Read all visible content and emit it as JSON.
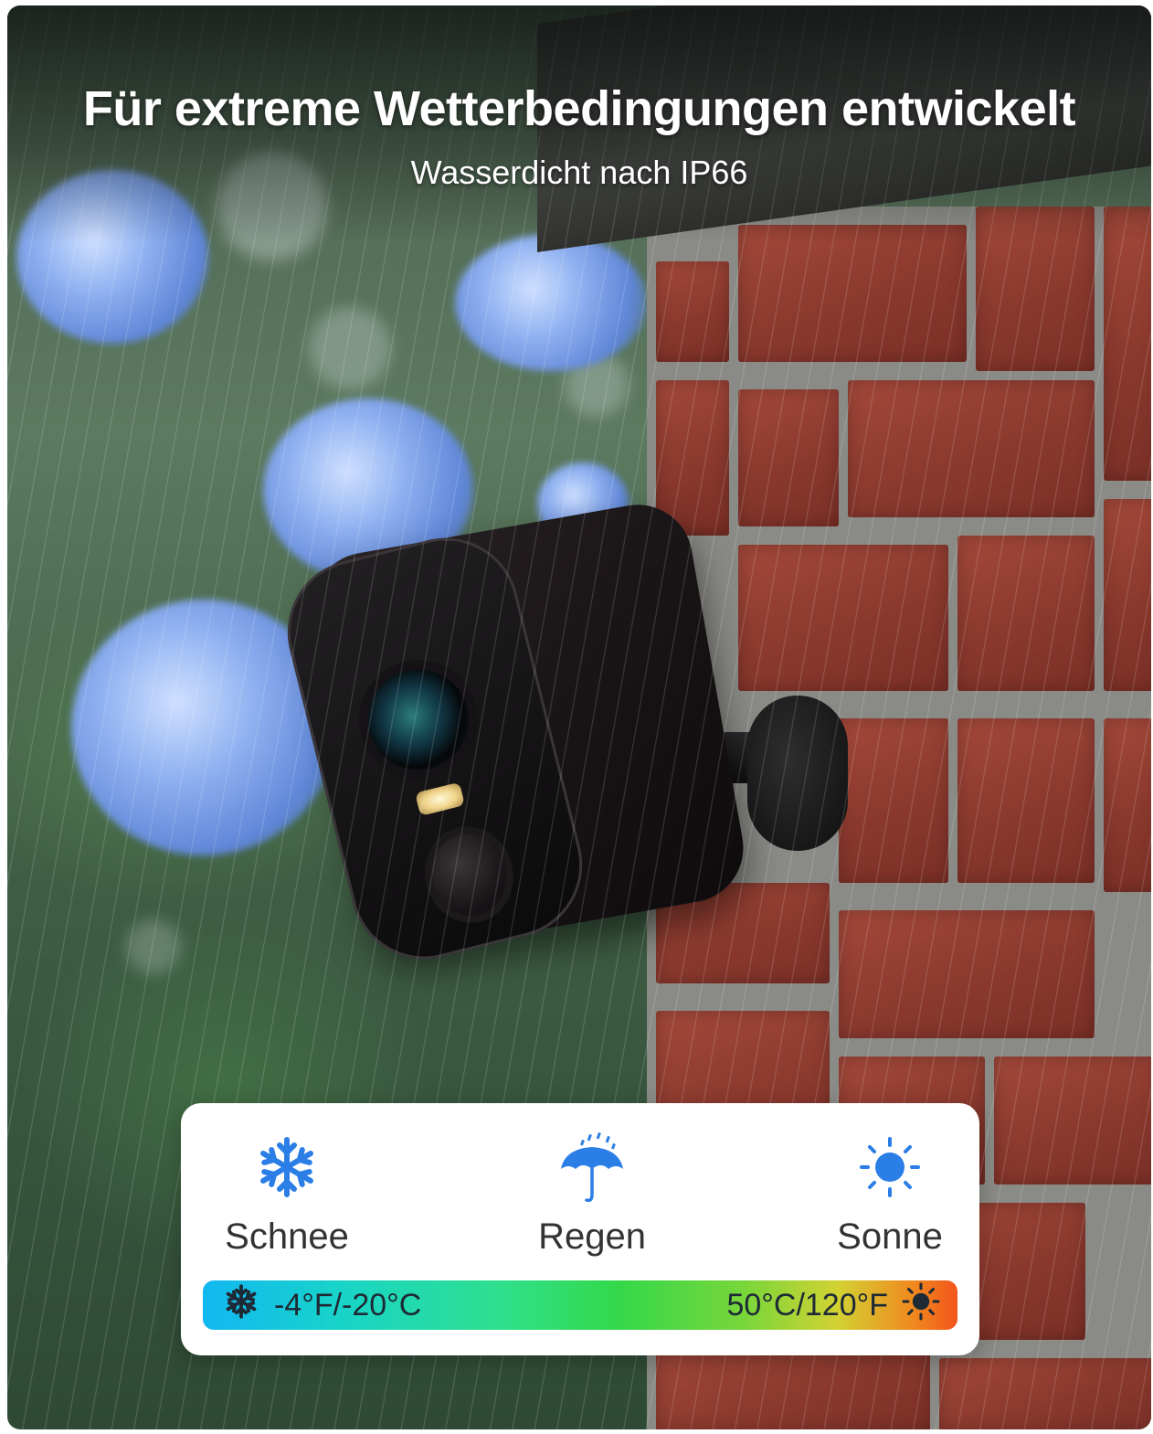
{
  "headline": {
    "title": "Für extreme Wetterbedingungen entwickelt",
    "subtitle": "Wasserdicht nach IP66"
  },
  "conditions": [
    {
      "label": "Schnee",
      "icon": "snowflake-icon"
    },
    {
      "label": "Regen",
      "icon": "umbrella-rain-icon"
    },
    {
      "label": "Sonne",
      "icon": "sun-icon"
    }
  ],
  "temperature_range": {
    "min_label": "-4°F/-20°C",
    "max_label": "50°C/120°F",
    "min_icon": "snowflake-icon",
    "max_icon": "sun-icon"
  },
  "colors": {
    "icon_blue": "#2b7ee6",
    "label_gray": "#333333",
    "bar_start": "#12b7f2",
    "bar_mid": "#33d84a",
    "bar_end": "#f2551b"
  }
}
